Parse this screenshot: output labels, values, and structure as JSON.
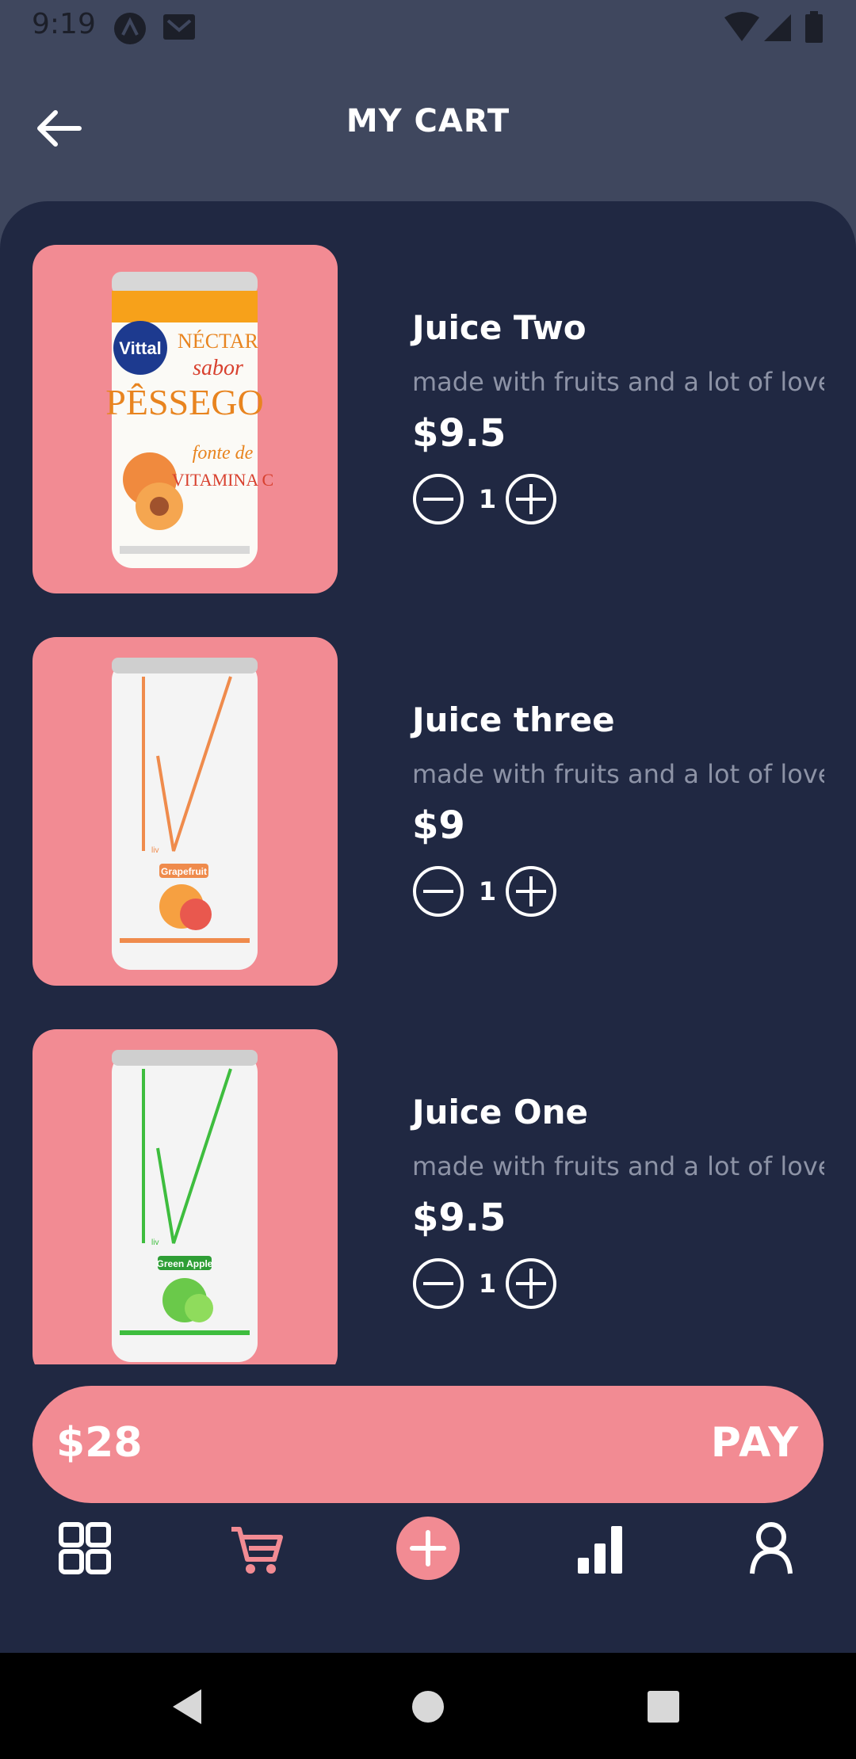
{
  "status_bar": {
    "time": "9:19"
  },
  "header": {
    "title": "MY CART"
  },
  "cart": {
    "items": [
      {
        "name": "Juice Two",
        "description": "made with fruits and a lot of love",
        "price": "$9.5",
        "quantity": "1"
      },
      {
        "name": "Juice three",
        "description": "made with fruits and a lot of love",
        "price": "$9",
        "quantity": "1"
      },
      {
        "name": "Juice One",
        "description": "made with fruits and a lot of love",
        "price": "$9.5",
        "quantity": "1"
      }
    ],
    "total": "$28",
    "pay_label": "PAY"
  },
  "bottom_nav": [
    {
      "icon": "grid-icon",
      "active": false
    },
    {
      "icon": "cart-icon",
      "active": true
    },
    {
      "icon": "plus-circle-icon",
      "active": false
    },
    {
      "icon": "bar-chart-icon",
      "active": false
    },
    {
      "icon": "user-icon",
      "active": false
    }
  ],
  "product_labels": {
    "can1_brand": "Vittal",
    "can1_line1": "NÉCTAR",
    "can1_line2": "sabor",
    "can1_line3": "PÊSSEGO",
    "can1_line4": "fonte de",
    "can1_line5": "VITAMINA C",
    "can2_brand": "liv",
    "can2_flavor": "Grapefruit",
    "can3_brand": "liv",
    "can3_flavor": "Green Apple"
  },
  "colors": {
    "accent": "#f28b93",
    "panel": "#202842",
    "header": "#3f475e"
  }
}
